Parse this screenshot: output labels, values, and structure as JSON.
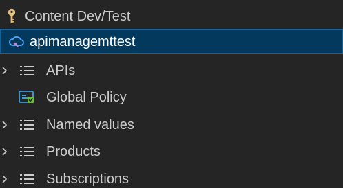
{
  "colors": {
    "background": "#252526",
    "selected_background": "#04395e",
    "selected_border": "#0e639c",
    "text": "#cccccc",
    "key_icon": "#e5c07b",
    "cloud_icon": "#4fa8ff"
  },
  "tree": {
    "subscription": {
      "label": "Content Dev/Test",
      "icon": "key-icon"
    },
    "service": {
      "label": "apimanagemttest",
      "icon": "cloud-icon"
    },
    "items": [
      {
        "label": "APIs",
        "icon": "list-icon",
        "expandable": true
      },
      {
        "label": "Global Policy",
        "icon": "policy-icon",
        "expandable": false
      },
      {
        "label": "Named values",
        "icon": "list-icon",
        "expandable": true
      },
      {
        "label": "Products",
        "icon": "list-icon",
        "expandable": true
      },
      {
        "label": "Subscriptions",
        "icon": "list-icon",
        "expandable": true
      }
    ]
  }
}
